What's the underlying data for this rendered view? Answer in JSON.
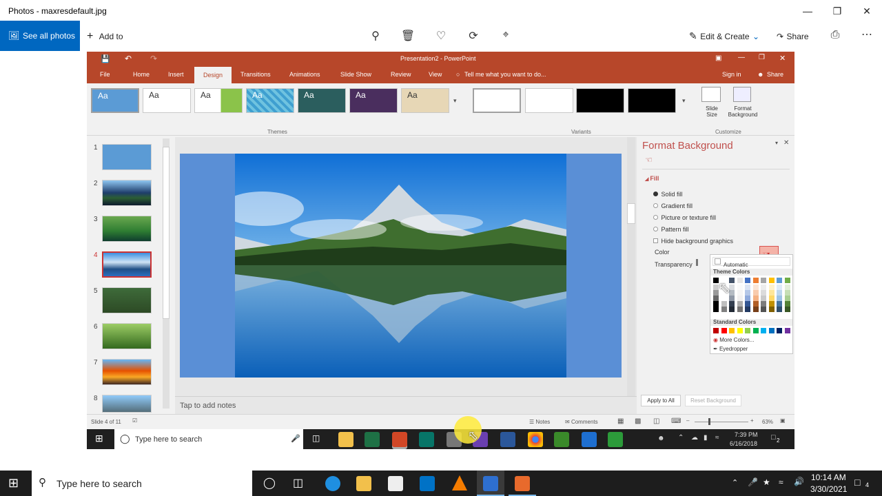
{
  "photos": {
    "window_title": "Photos - maxresdefault.jpg",
    "see_all": "See all photos",
    "add_to": "Add to",
    "edit_create": "Edit & Create",
    "share": "Share"
  },
  "ppt": {
    "title": "Presentation2 - PowerPoint",
    "tabs": [
      "File",
      "Home",
      "Insert",
      "Design",
      "Transitions",
      "Animations",
      "Slide Show",
      "Review",
      "View"
    ],
    "tell_me": "Tell me what you want to do...",
    "sign_in": "Sign in",
    "share": "Share",
    "theme_label": "Aa",
    "groups": {
      "themes": "Themes",
      "variants": "Variants",
      "customize": "Customize"
    },
    "slide_size": "Slide Size",
    "format_background": "Format Background",
    "slide_numbers": [
      "1",
      "2",
      "3",
      "4",
      "5",
      "6",
      "7",
      "8"
    ],
    "notes_placeholder": "Tap to add notes",
    "status": {
      "slide_of": "Slide 4 of 11",
      "notes": "Notes",
      "comments": "Comments",
      "zoom": "63%"
    },
    "pane": {
      "title": "Format Background",
      "fill": "Fill",
      "options": [
        "Solid fill",
        "Gradient fill",
        "Picture or texture fill",
        "Pattern fill"
      ],
      "hide_bg": "Hide background graphics",
      "color": "Color",
      "transparency": "Transparency",
      "apply_all": "Apply to All",
      "reset": "Reset Background"
    },
    "picker": {
      "automatic": "Automatic",
      "theme_colors": "Theme Colors",
      "standard_colors": "Standard Colors",
      "more_colors": "More Colors...",
      "eyedropper": "Eyedropper",
      "theme_row": [
        "#000000",
        "#ffffff",
        "#44546a",
        "#e7e6e6",
        "#4472c4",
        "#ed7d31",
        "#a5a5a5",
        "#ffc000",
        "#5b9bd5",
        "#70ad47"
      ],
      "standard_row": [
        "#c00000",
        "#ff0000",
        "#ffc000",
        "#ffff00",
        "#92d050",
        "#00b050",
        "#00b0f0",
        "#0070c0",
        "#002060",
        "#7030a0"
      ]
    }
  },
  "inner_taskbar": {
    "search": "Type here to search",
    "time": "7:39 PM",
    "date": "6/16/2018",
    "notif": "2"
  },
  "taskbar": {
    "search": "Type here to search",
    "time": "10:14 AM",
    "date": "3/30/2021",
    "notif": "4"
  }
}
